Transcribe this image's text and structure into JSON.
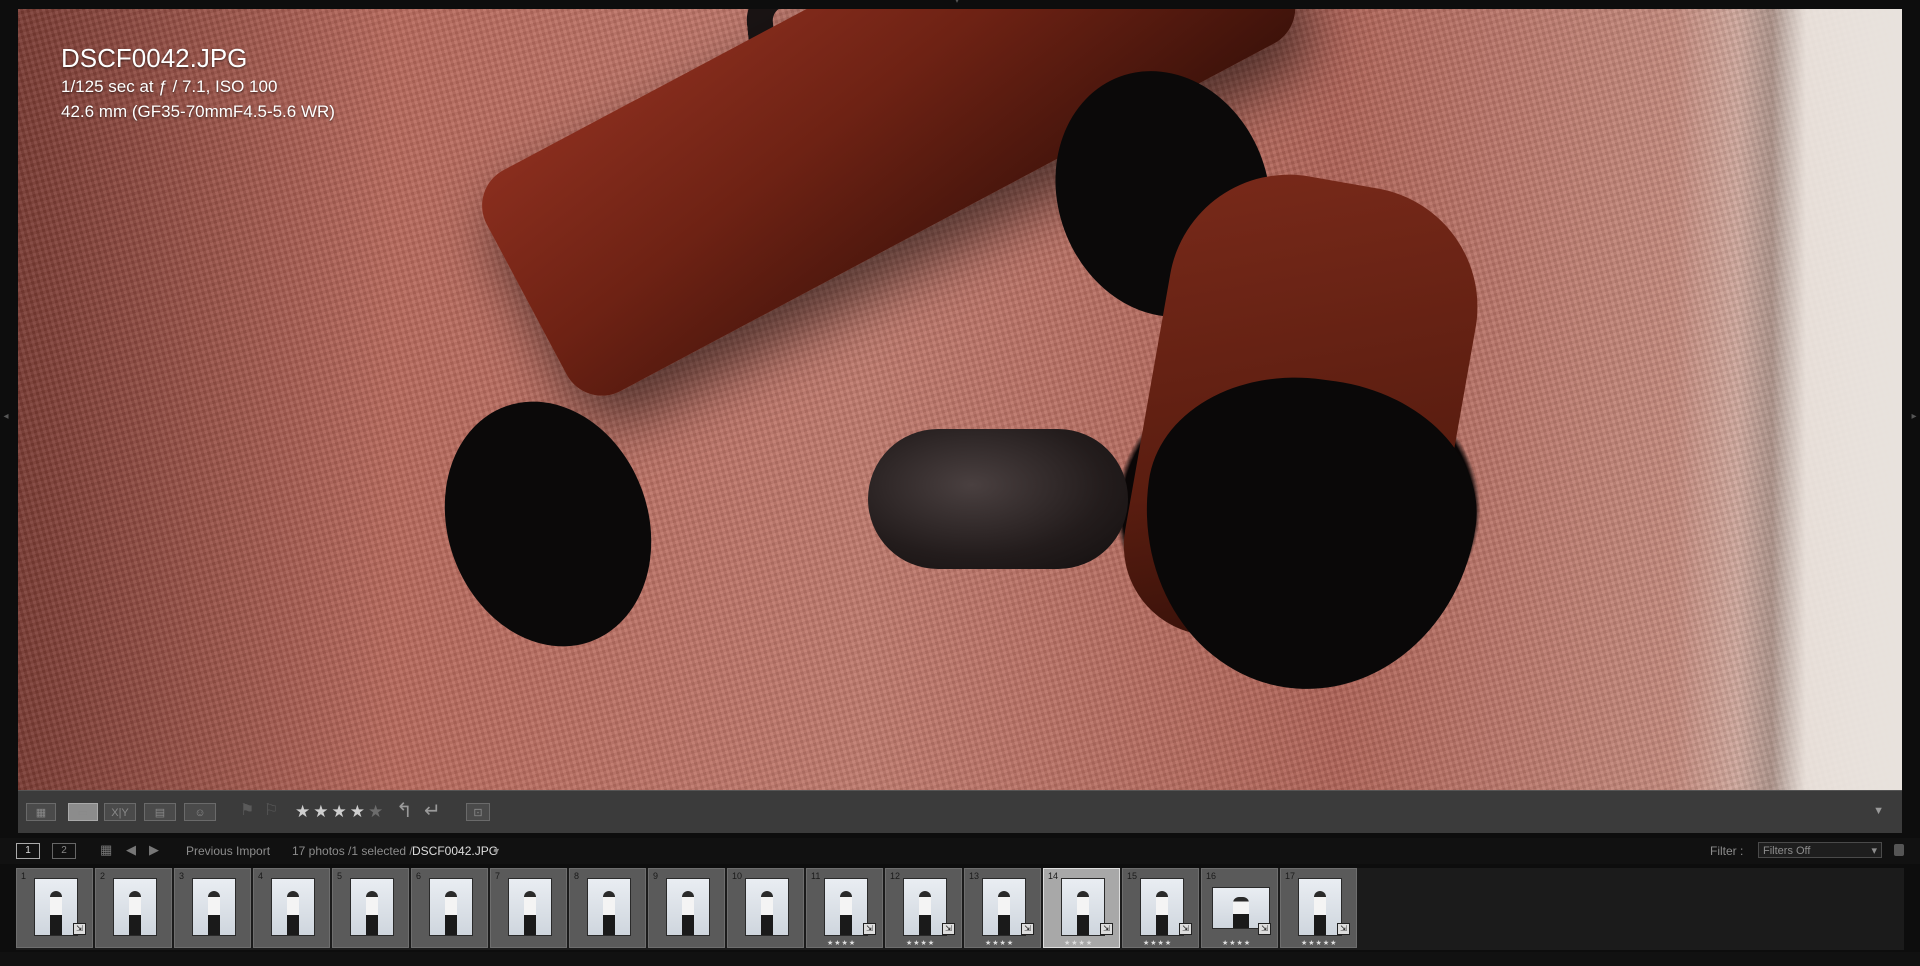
{
  "photo": {
    "filename": "DSCF0042.JPG",
    "exposure": "1/125 sec at ƒ / 7.1, ISO 100",
    "lens": "42.6 mm (GF35-70mmF4.5-5.6 WR)"
  },
  "toolbar": {
    "view_buttons": [
      "grid-view",
      "loupe-view",
      "compare-view",
      "survey-view",
      "people-view"
    ],
    "compare_label": "X|Y",
    "rating": 4,
    "rating_max": 5,
    "stars_on": "★★★★",
    "stars_off": "★"
  },
  "filmstrip_header": {
    "monitor1": "1",
    "monitor2": "2",
    "source": "Previous Import",
    "count": "17 photos /1 selected /",
    "selected_file": "DSCF0042.JPG",
    "filter_label": "Filter :",
    "filter_value": "Filters Off"
  },
  "filmstrip": {
    "selected_index": 14,
    "cells": [
      {
        "num": "1",
        "stars": "",
        "badge": true,
        "wide": false
      },
      {
        "num": "2",
        "stars": "",
        "badge": false,
        "wide": false
      },
      {
        "num": "3",
        "stars": "",
        "badge": false,
        "wide": false
      },
      {
        "num": "4",
        "stars": "",
        "badge": false,
        "wide": false
      },
      {
        "num": "5",
        "stars": "",
        "badge": false,
        "wide": false
      },
      {
        "num": "6",
        "stars": "",
        "badge": false,
        "wide": false
      },
      {
        "num": "7",
        "stars": "",
        "badge": false,
        "wide": false
      },
      {
        "num": "8",
        "stars": "",
        "badge": false,
        "wide": false
      },
      {
        "num": "9",
        "stars": "",
        "badge": false,
        "wide": false
      },
      {
        "num": "10",
        "stars": "",
        "badge": false,
        "wide": false
      },
      {
        "num": "11",
        "stars": "★★★★",
        "badge": true,
        "wide": false
      },
      {
        "num": "12",
        "stars": "★★★★",
        "badge": true,
        "wide": false
      },
      {
        "num": "13",
        "stars": "★★★★",
        "badge": true,
        "wide": false
      },
      {
        "num": "14",
        "stars": "★★★★",
        "badge": true,
        "wide": false
      },
      {
        "num": "15",
        "stars": "★★★★",
        "badge": true,
        "wide": false
      },
      {
        "num": "16",
        "stars": "★★★★",
        "badge": true,
        "wide": true
      },
      {
        "num": "17",
        "stars": "★★★★★",
        "badge": true,
        "wide": false
      }
    ]
  }
}
